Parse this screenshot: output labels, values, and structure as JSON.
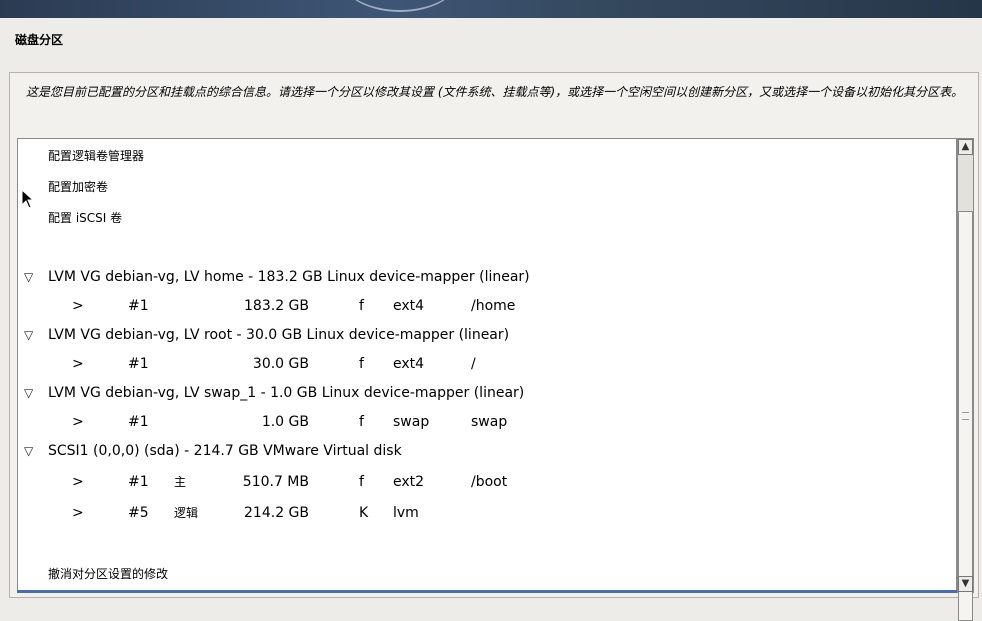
{
  "header": {
    "title": "磁盘分区"
  },
  "description": "这是您目前已配置的分区和挂载点的综合信息。请选择一个分区以修改其设置 (文件系统、挂载点等)，或选择一个空闲空间以创建新分区，又或选择一个设备以初始化其分区表。",
  "menu": [
    {
      "label": "配置逻辑卷管理器"
    },
    {
      "label": "配置加密卷"
    },
    {
      "label": "配置 iSCSI 卷"
    }
  ],
  "devices": [
    {
      "label": "LVM VG debian-vg, LV home - 183.2 GB Linux device-mapper (linear)",
      "partitions": [
        {
          "marker": ">",
          "num": "#1",
          "type": "",
          "size": "183.2 GB",
          "flag": "f",
          "fs": "ext4",
          "mount": "/home"
        }
      ]
    },
    {
      "label": "LVM VG debian-vg, LV root - 30.0 GB Linux device-mapper (linear)",
      "partitions": [
        {
          "marker": ">",
          "num": "#1",
          "type": "",
          "size": "30.0 GB",
          "flag": "f",
          "fs": "ext4",
          "mount": "/"
        }
      ]
    },
    {
      "label": "LVM VG debian-vg, LV swap_1 - 1.0 GB Linux device-mapper (linear)",
      "partitions": [
        {
          "marker": ">",
          "num": "#1",
          "type": "",
          "size": "1.0 GB",
          "flag": "f",
          "fs": "swap",
          "mount": "swap"
        }
      ]
    },
    {
      "label": "SCSI1 (0,0,0) (sda) - 214.7 GB VMware Virtual disk",
      "partitions": [
        {
          "marker": ">",
          "num": "#1",
          "type": "主",
          "size": "510.7 MB",
          "flag": "f",
          "fs": "ext2",
          "mount": "/boot"
        },
        {
          "marker": ">",
          "num": "#5",
          "type": "逻辑",
          "size": "214.2 GB",
          "flag": "K",
          "fs": "lvm",
          "mount": ""
        }
      ]
    }
  ],
  "footer_action": {
    "label": "撤消对分区设置的修改"
  },
  "icons": {
    "expand": "triangle-down-icon",
    "scroll_up": "arrow-up-icon",
    "scroll_down": "arrow-down-icon",
    "cursor": "mouse-pointer-icon"
  }
}
